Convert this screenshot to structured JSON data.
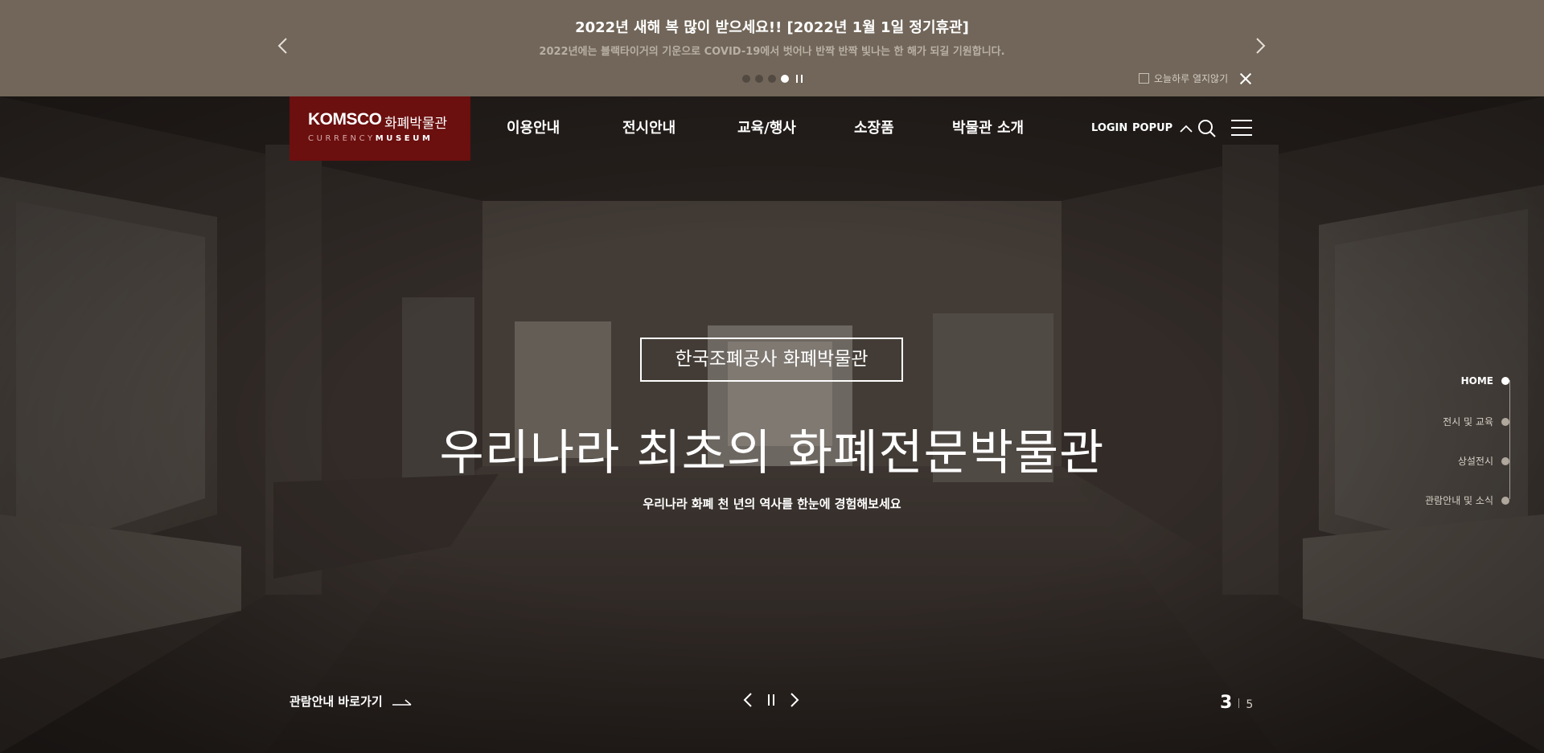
{
  "popup": {
    "title": "2022년 새해 복 많이 받으세요!! [2022년 1월 1일 정기휴관]",
    "subtitle": "2022년에는 블랙타이거의 기운으로 COVID-19에서 벗어나 반짝 반짝 빛나는 한 해가 되길 기원합니다.",
    "prev_icon": "chevron-left-icon",
    "next_icon": "chevron-right-icon",
    "slides_total": 4,
    "slide_active": 4,
    "dismiss_label": "오늘하루 열지않기",
    "close_icon": "close-icon"
  },
  "header": {
    "logo_brand": "KOMSCO",
    "logo_name": "화폐박물관",
    "logo_sub_left": "CURRENCY",
    "logo_sub_right": "MUSEUM",
    "menu": [
      {
        "label": "이용안내"
      },
      {
        "label": "전시안내"
      },
      {
        "label": "교육/행사"
      },
      {
        "label": "소장품"
      },
      {
        "label": "박물관 소개"
      }
    ],
    "login_label": "LOGIN",
    "popup_label": "POPUP",
    "search_icon": "search-icon",
    "menu_icon": "hamburger-icon"
  },
  "hero": {
    "badge": "한국조폐공사 화폐박물관",
    "title": "우리나라 최초의 화폐전문박물관",
    "subtitle": "우리나라 화폐 천 년의 역사를 한눈에 경험해보세요"
  },
  "side_nav": [
    {
      "label": "HOME",
      "active": true
    },
    {
      "label": "전시 및 교육",
      "active": false
    },
    {
      "label": "상설전시",
      "active": false
    },
    {
      "label": "관람안내 및 소식",
      "active": false
    }
  ],
  "footer_controls": {
    "guide_link": "관람안내 바로가기",
    "current_slide": "3",
    "total_slides": "5"
  },
  "colors": {
    "popup_bg": "#716659",
    "logo_bg": "#6b0f0f",
    "hero_dark": "#2a2522"
  }
}
